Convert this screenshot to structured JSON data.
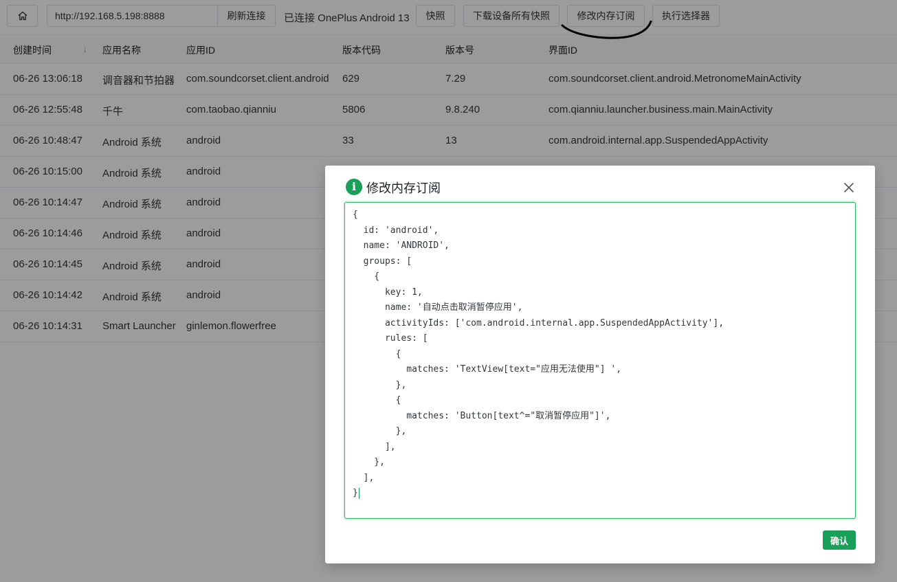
{
  "toolbar": {
    "home_icon": "home-icon",
    "url_value": "http://192.168.5.198:8888",
    "refresh_label": "刷新连接",
    "status_text": "已连接 OnePlus Android 13",
    "snapshot_label": "快照",
    "download_all_label": "下载设备所有快照",
    "modify_subs_label": "修改内存订阅",
    "exec_selector_label": "执行选择器"
  },
  "table": {
    "headers": [
      "创建时间",
      "应用名称",
      "应用ID",
      "版本代码",
      "版本号",
      "界面ID"
    ],
    "sort_icon": "arrow-down-icon",
    "rows": [
      [
        "06-26 13:06:18",
        "调音器和节拍器",
        "com.soundcorset.client.android",
        "629",
        "7.29",
        "com.soundcorset.client.android.MetronomeMainActivity"
      ],
      [
        "06-26 12:55:48",
        "千牛",
        "com.taobao.qianniu",
        "5806",
        "9.8.240",
        "com.qianniu.launcher.business.main.MainActivity"
      ],
      [
        "06-26 10:48:47",
        "Android 系统",
        "android",
        "33",
        "13",
        "com.android.internal.app.SuspendedAppActivity"
      ],
      [
        "06-26 10:15:00",
        "Android 系统",
        "android",
        "",
        "",
        ""
      ],
      [
        "06-26 10:14:47",
        "Android 系统",
        "android",
        "",
        "",
        ""
      ],
      [
        "06-26 10:14:46",
        "Android 系统",
        "android",
        "",
        "",
        ""
      ],
      [
        "06-26 10:14:45",
        "Android 系统",
        "android",
        "",
        "",
        ""
      ],
      [
        "06-26 10:14:42",
        "Android 系统",
        "android",
        "",
        "",
        ""
      ],
      [
        "06-26 10:14:31",
        "Smart Launcher",
        "ginlemon.flowerfree",
        "",
        "",
        ""
      ]
    ]
  },
  "modal": {
    "icon": "info-icon",
    "icon_glyph": "i",
    "title": "修改内存订阅",
    "close_icon": "close-icon",
    "code": "{\n  id: 'android',\n  name: 'ANDROID',\n  groups: [\n    {\n      key: 1,\n      name: '自动点击取消暂停应用',\n      activityIds: ['com.android.internal.app.SuspendedAppActivity'],\n      rules: [\n        {\n          matches: 'TextView[text=\"应用无法使用\"] ',\n        },\n        {\n          matches: 'Button[text^=\"取消暂停应用\"]',\n        },\n      ],\n    },\n  ],\n}",
    "confirm_label": "确认"
  },
  "colors": {
    "primary": "#18a058",
    "overlay": "rgba(0,0,0,0.39)",
    "annotation": "#000000"
  }
}
